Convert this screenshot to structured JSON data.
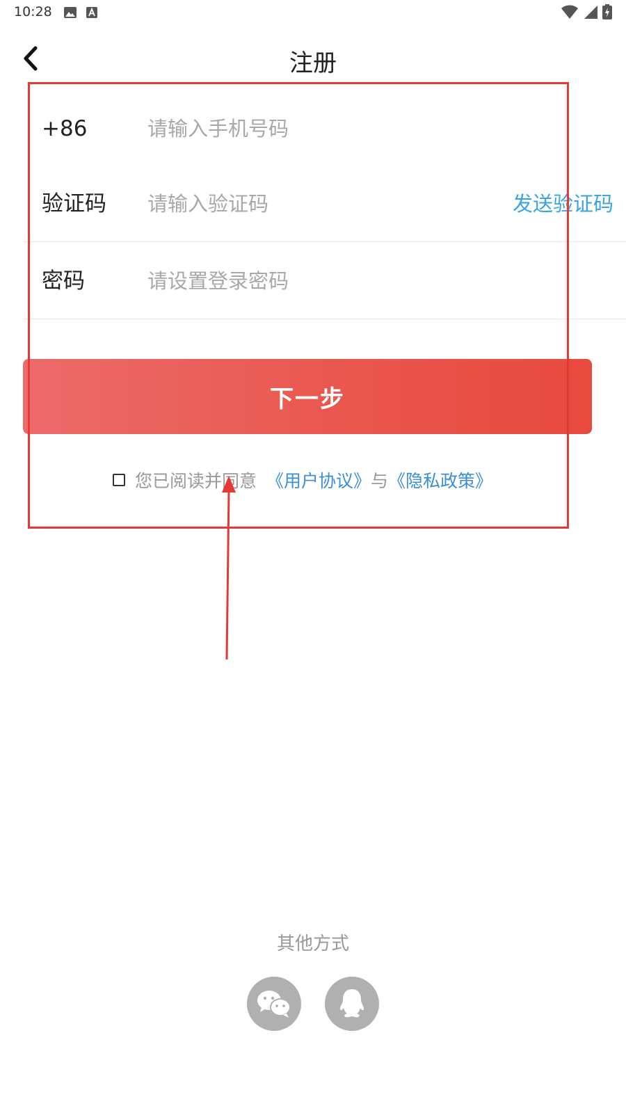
{
  "status_bar": {
    "time": "10:28"
  },
  "nav": {
    "title": "注册",
    "back_icon": "chevron-left-icon"
  },
  "form": {
    "phone": {
      "label": "+86",
      "placeholder": "请输入手机号码",
      "value": ""
    },
    "code": {
      "label": "验证码",
      "placeholder": "请输入验证码",
      "value": "",
      "send_label": "发送验证码"
    },
    "password": {
      "label": "密码",
      "placeholder": "请设置登录密码",
      "value": ""
    }
  },
  "next_button": {
    "label": "下一步"
  },
  "agreement": {
    "checked": false,
    "text": "您已阅读并同意",
    "user_agreement_link": "《用户协议》",
    "and_text": "与",
    "privacy_policy_link": "《隐私政策》"
  },
  "other_methods": {
    "label": "其他方式",
    "options": [
      {
        "icon": "wechat-icon"
      },
      {
        "icon": "qq-icon"
      }
    ]
  },
  "colors": {
    "accent": "#e9564d",
    "link": "#3a8fd8",
    "send_code": "#3aa3e3",
    "annotation": "#e53935"
  }
}
